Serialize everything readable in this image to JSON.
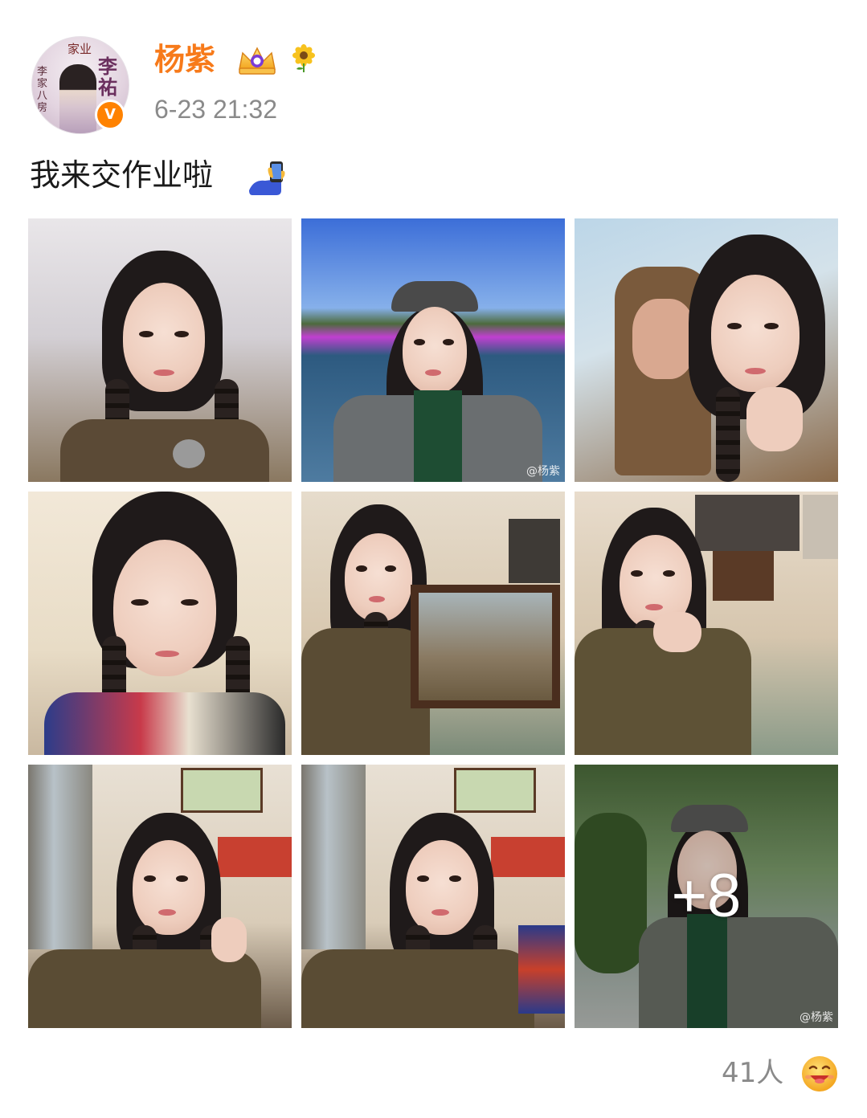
{
  "post": {
    "author": {
      "avatar_name": "avatar",
      "avatar_text_top": "家业",
      "avatar_text_left": "李家八房",
      "avatar_text_right": "李祐",
      "verified_badge": "V",
      "username": "杨紫",
      "badges": [
        "crown-icon",
        "sunflower-icon"
      ]
    },
    "timestamp": "6-23 21:32",
    "text": "我来交作业啦",
    "text_emoji": "selfie-icon",
    "images": {
      "more_count": "+8",
      "watermark": "@杨紫"
    },
    "reactions": {
      "count_text": "41人",
      "icon": "laughing-face-icon"
    }
  },
  "colors": {
    "username": "#f77a1a",
    "verified": "#ff8200",
    "timestamp": "#8a8a8a",
    "text": "#1a1a1a"
  }
}
